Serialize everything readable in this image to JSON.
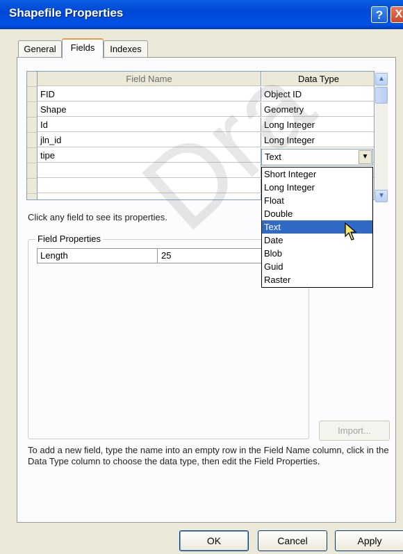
{
  "window": {
    "title": "Shapefile Properties",
    "help": "?",
    "close": "X"
  },
  "tabs": [
    {
      "label": "General"
    },
    {
      "label": "Fields",
      "active": true
    },
    {
      "label": "Indexes"
    }
  ],
  "grid": {
    "headers": {
      "field_name": "Field Name",
      "data_type": "Data Type"
    },
    "rows": [
      {
        "name": "FID",
        "type": "Object ID"
      },
      {
        "name": "Shape",
        "type": "Geometry"
      },
      {
        "name": "Id",
        "type": "Long Integer"
      },
      {
        "name": "jln_id",
        "type": "Long Integer"
      },
      {
        "name": "tipe",
        "type": "Text"
      },
      {
        "name": "",
        "type": ""
      },
      {
        "name": "",
        "type": ""
      },
      {
        "name": "",
        "type": ""
      }
    ]
  },
  "combo": {
    "value": "Text",
    "arrow": "▼"
  },
  "dropdown": {
    "options": [
      "Short Integer",
      "Long Integer",
      "Float",
      "Double",
      "Text",
      "Date",
      "Blob",
      "Guid",
      "Raster"
    ],
    "selected_index": 4
  },
  "hint": "Click any field to see its properties.",
  "field_properties": {
    "legend": "Field Properties",
    "name": "Length",
    "value": "25"
  },
  "import_button": "Import...",
  "instructions": "To add a new field, type the name into an empty row in the Field Name column, click in the Data Type column to choose the data type, then edit the Field Properties.",
  "buttons": {
    "ok": "OK",
    "cancel": "Cancel",
    "apply": "Apply"
  },
  "watermark": "Dra",
  "colors": {
    "title_bar": "#0054e3",
    "selection": "#316ac5",
    "dialog_bg": "#ece9d8"
  }
}
